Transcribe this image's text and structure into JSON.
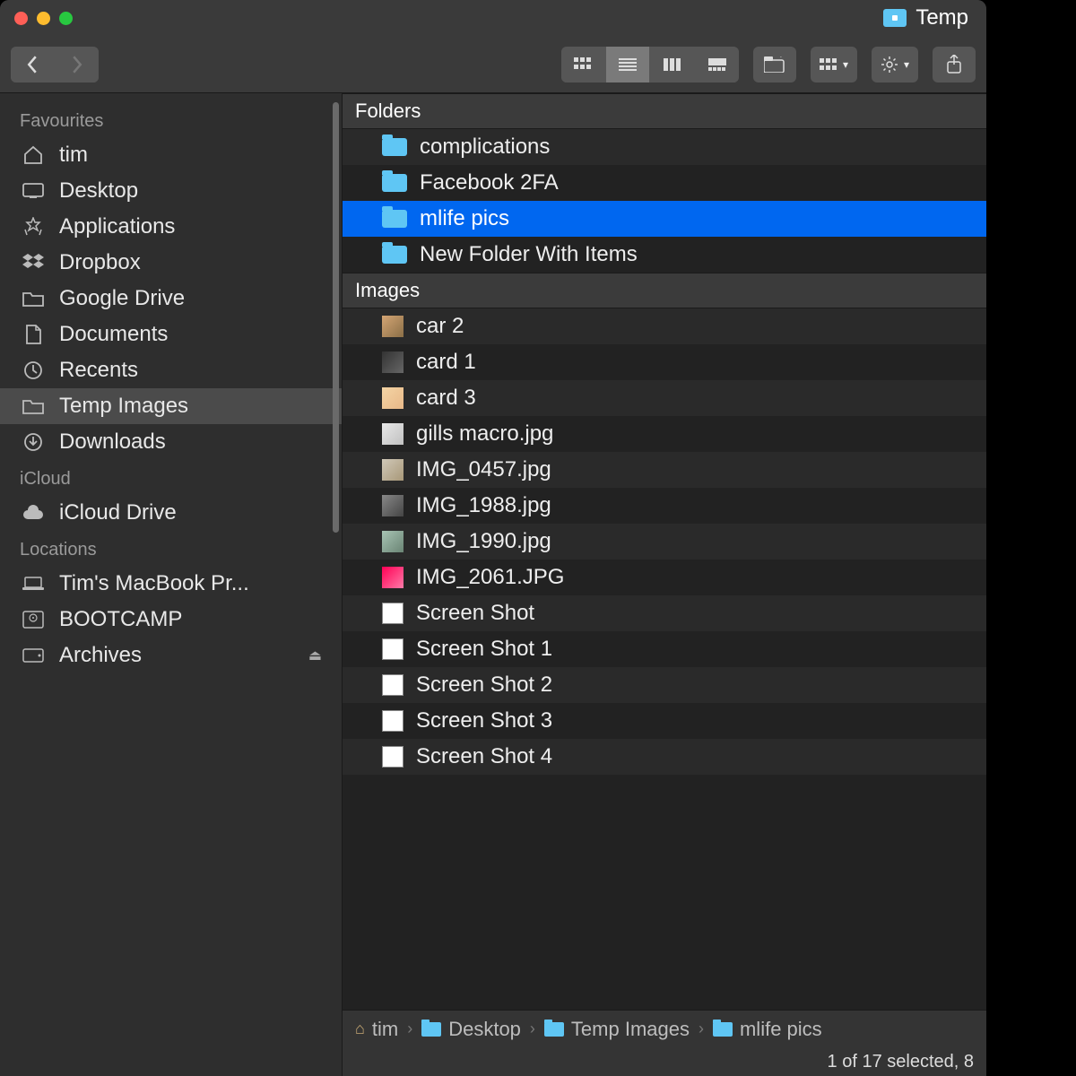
{
  "window": {
    "title": "Temp"
  },
  "sidebar": {
    "sections": [
      {
        "label": "Favourites",
        "items": [
          {
            "icon": "home",
            "label": "tim"
          },
          {
            "icon": "desktop",
            "label": "Desktop"
          },
          {
            "icon": "apps",
            "label": "Applications"
          },
          {
            "icon": "dropbox",
            "label": "Dropbox"
          },
          {
            "icon": "folder",
            "label": "Google Drive"
          },
          {
            "icon": "documents",
            "label": "Documents"
          },
          {
            "icon": "recents",
            "label": "Recents"
          },
          {
            "icon": "folder",
            "label": "Temp Images",
            "active": true
          },
          {
            "icon": "downloads",
            "label": "Downloads"
          }
        ]
      },
      {
        "label": "iCloud",
        "items": [
          {
            "icon": "cloud",
            "label": "iCloud Drive"
          }
        ]
      },
      {
        "label": "Locations",
        "items": [
          {
            "icon": "laptop",
            "label": "Tim's MacBook Pr..."
          },
          {
            "icon": "disk",
            "label": "BOOTCAMP"
          },
          {
            "icon": "drive",
            "label": "Archives",
            "eject": true
          }
        ]
      }
    ]
  },
  "content": {
    "sections": [
      {
        "header": "Folders",
        "items": [
          {
            "type": "folder",
            "name": "complications"
          },
          {
            "type": "folder",
            "name": "Facebook 2FA"
          },
          {
            "type": "folder",
            "name": "mlife pics",
            "selected": true
          },
          {
            "type": "folder",
            "name": "New Folder With Items"
          }
        ]
      },
      {
        "header": "Images",
        "items": [
          {
            "type": "image",
            "thumb": "photo1",
            "name": "car 2"
          },
          {
            "type": "image",
            "thumb": "photo2",
            "name": "card 1"
          },
          {
            "type": "image",
            "thumb": "photo3",
            "name": "card 3"
          },
          {
            "type": "image",
            "thumb": "photo4",
            "name": "gills macro.jpg"
          },
          {
            "type": "image",
            "thumb": "photo5",
            "name": "IMG_0457.jpg"
          },
          {
            "type": "image",
            "thumb": "photo6",
            "name": "IMG_1988.jpg"
          },
          {
            "type": "image",
            "thumb": "photo7",
            "name": "IMG_1990.jpg"
          },
          {
            "type": "image",
            "thumb": "photo8",
            "name": "IMG_2061.JPG"
          },
          {
            "type": "image",
            "thumb": "blank",
            "name": "Screen Shot"
          },
          {
            "type": "image",
            "thumb": "blank",
            "name": "Screen Shot 1"
          },
          {
            "type": "image",
            "thumb": "blank",
            "name": "Screen Shot 2"
          },
          {
            "type": "image",
            "thumb": "blank",
            "name": "Screen Shot 3"
          },
          {
            "type": "image",
            "thumb": "blank",
            "name": "Screen Shot 4"
          }
        ]
      }
    ]
  },
  "pathbar": {
    "crumbs": [
      {
        "icon": "home",
        "label": "tim"
      },
      {
        "icon": "folder",
        "label": "Desktop"
      },
      {
        "icon": "folder",
        "label": "Temp Images"
      },
      {
        "icon": "folder",
        "label": "mlife pics"
      }
    ]
  },
  "status": {
    "text": "1 of 17 selected, 8"
  }
}
